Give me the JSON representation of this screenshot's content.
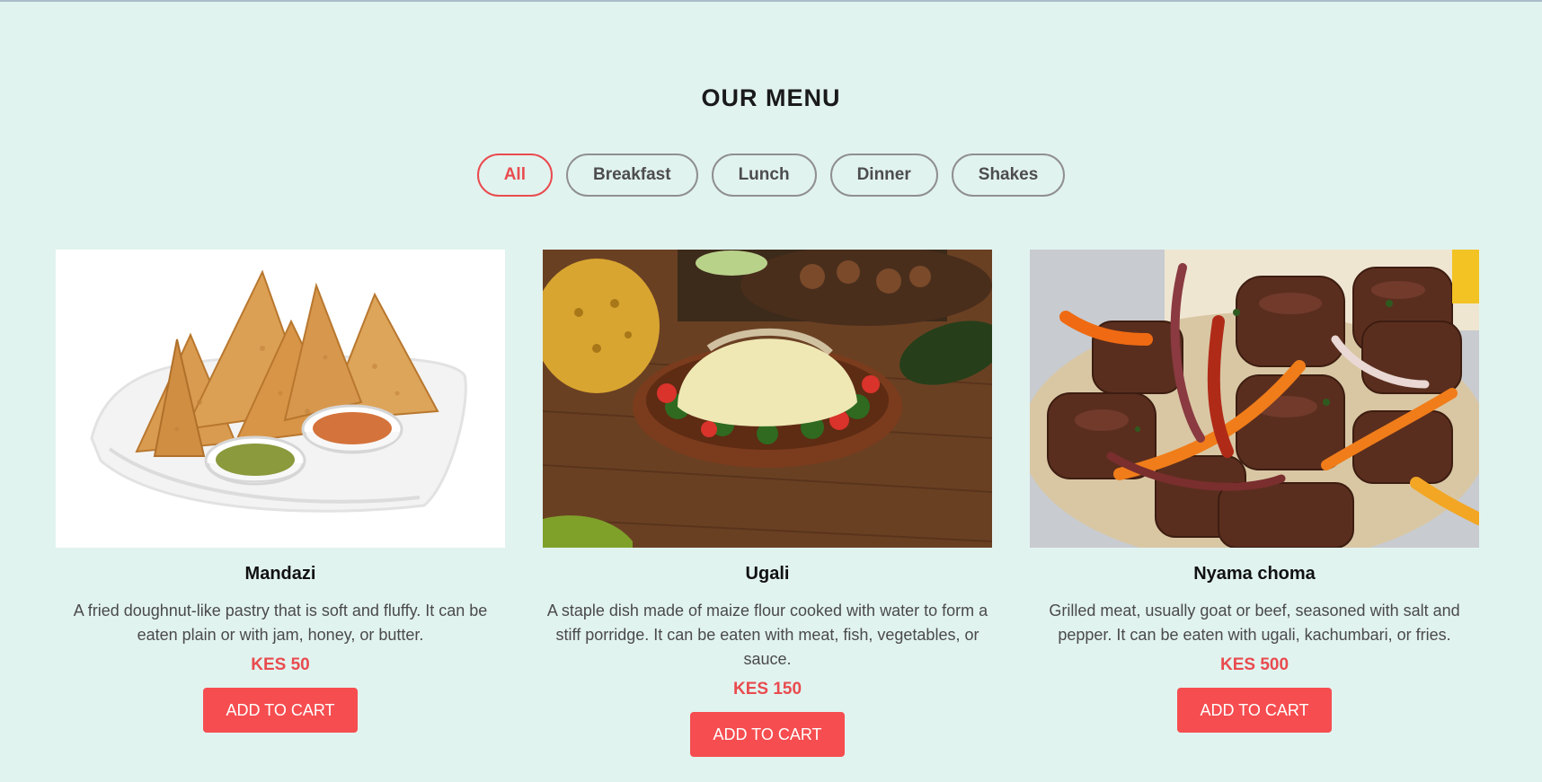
{
  "menu": {
    "title": "OUR MENU",
    "filters": [
      {
        "label": "All",
        "active": true
      },
      {
        "label": "Breakfast",
        "active": false
      },
      {
        "label": "Lunch",
        "active": false
      },
      {
        "label": "Dinner",
        "active": false
      },
      {
        "label": "Shakes",
        "active": false
      }
    ],
    "items": [
      {
        "name": "Mandazi",
        "description": "A fried doughnut-like pastry that is soft and fluffy. It can be eaten plain or with jam, honey, or butter.",
        "price": "KES 50",
        "button": "ADD TO CART"
      },
      {
        "name": "Ugali",
        "description": "A staple dish made of maize flour cooked with water to form a stiff porridge. It can be eaten with meat, fish, vegetables, or sauce.",
        "price": "KES 150",
        "button": "ADD TO CART"
      },
      {
        "name": "Nyama choma",
        "description": "Grilled meat, usually goat or beef, seasoned with salt and pepper. It can be eaten with ugali, kachumbari, or fries.",
        "price": "KES 500",
        "button": "ADD TO CART"
      }
    ]
  },
  "colors": {
    "background": "#e1f3ef",
    "accent": "#e94b4f",
    "button": "#f64d50",
    "filter_border": "#8f8f8f"
  }
}
